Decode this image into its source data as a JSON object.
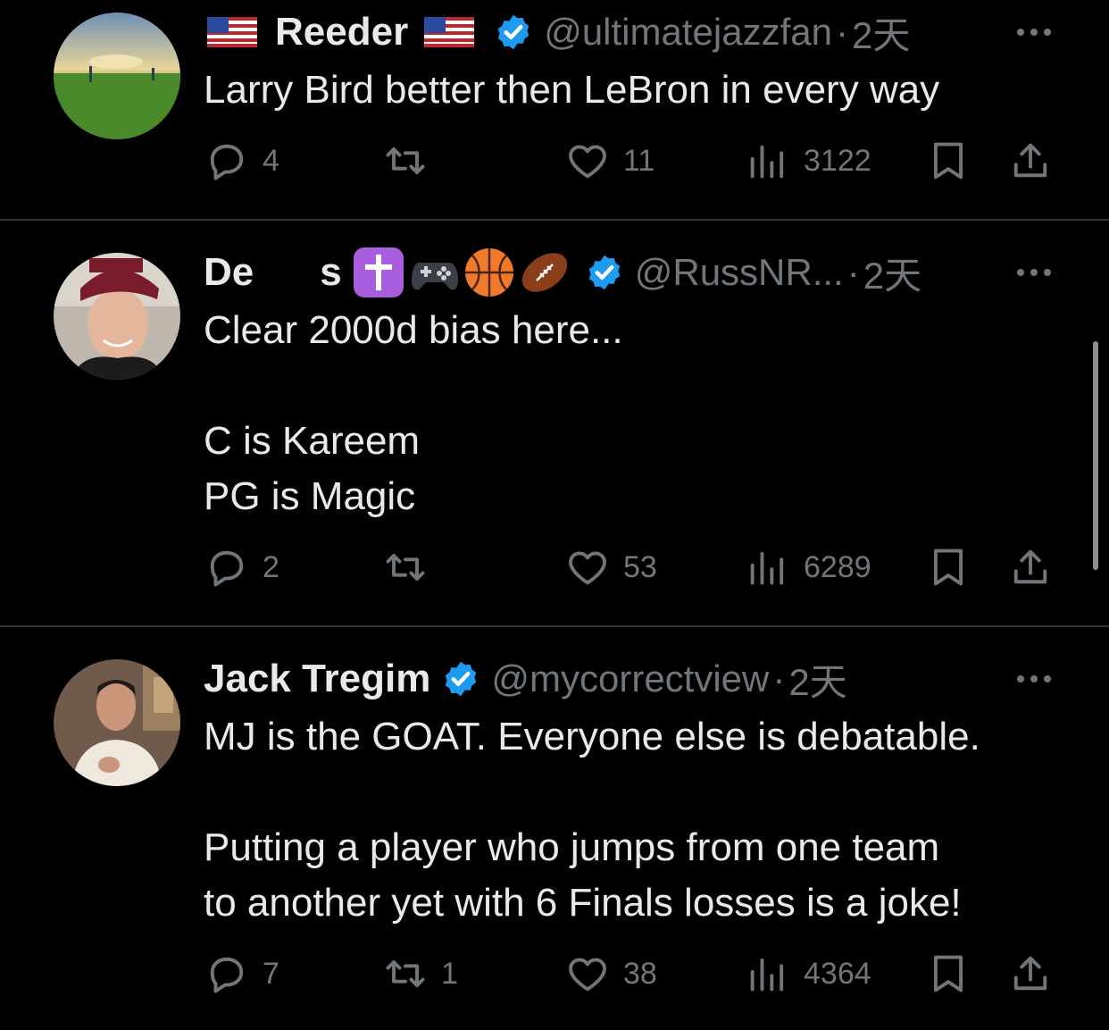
{
  "tweets": [
    {
      "name": "Reeder",
      "name_prefix_icon": "us-flag-icon",
      "name_suffix_icon": "us-flag-icon",
      "verified": true,
      "handle": "@ultimatejazzfan",
      "separator": "·",
      "time": "2天",
      "text": "Larry Bird better then LeBron in every way",
      "replies": "4",
      "retweets": "",
      "likes": "11",
      "views": "3122"
    },
    {
      "name_start": "De",
      "name_end": "s",
      "name_emojis": [
        "latin-cross-icon",
        "game-controller-icon",
        "basketball-icon",
        "american-football-icon"
      ],
      "verified": true,
      "handle": "@RussNR...",
      "separator": "·",
      "time": "2天",
      "text": "Clear 2000d bias here...\n\nC is Kareem\nPG is Magic",
      "replies": "2",
      "retweets": "",
      "likes": "53",
      "views": "6289"
    },
    {
      "name": "Jack Tregim",
      "verified": true,
      "handle": "@mycorrectview",
      "separator": "·",
      "time": "2天",
      "text": "MJ is the GOAT. Everyone else is debatable.\n\nPutting a player who jumps from one team\nto another yet with 6 Finals losses is a joke!",
      "replies": "7",
      "retweets": "1",
      "likes": "38",
      "views": "4364"
    }
  ],
  "colors": {
    "background": "#000000",
    "text": "#e7e9ea",
    "muted": "#71767b",
    "verified": "#1d9bf0",
    "divider": "#2f3336"
  }
}
